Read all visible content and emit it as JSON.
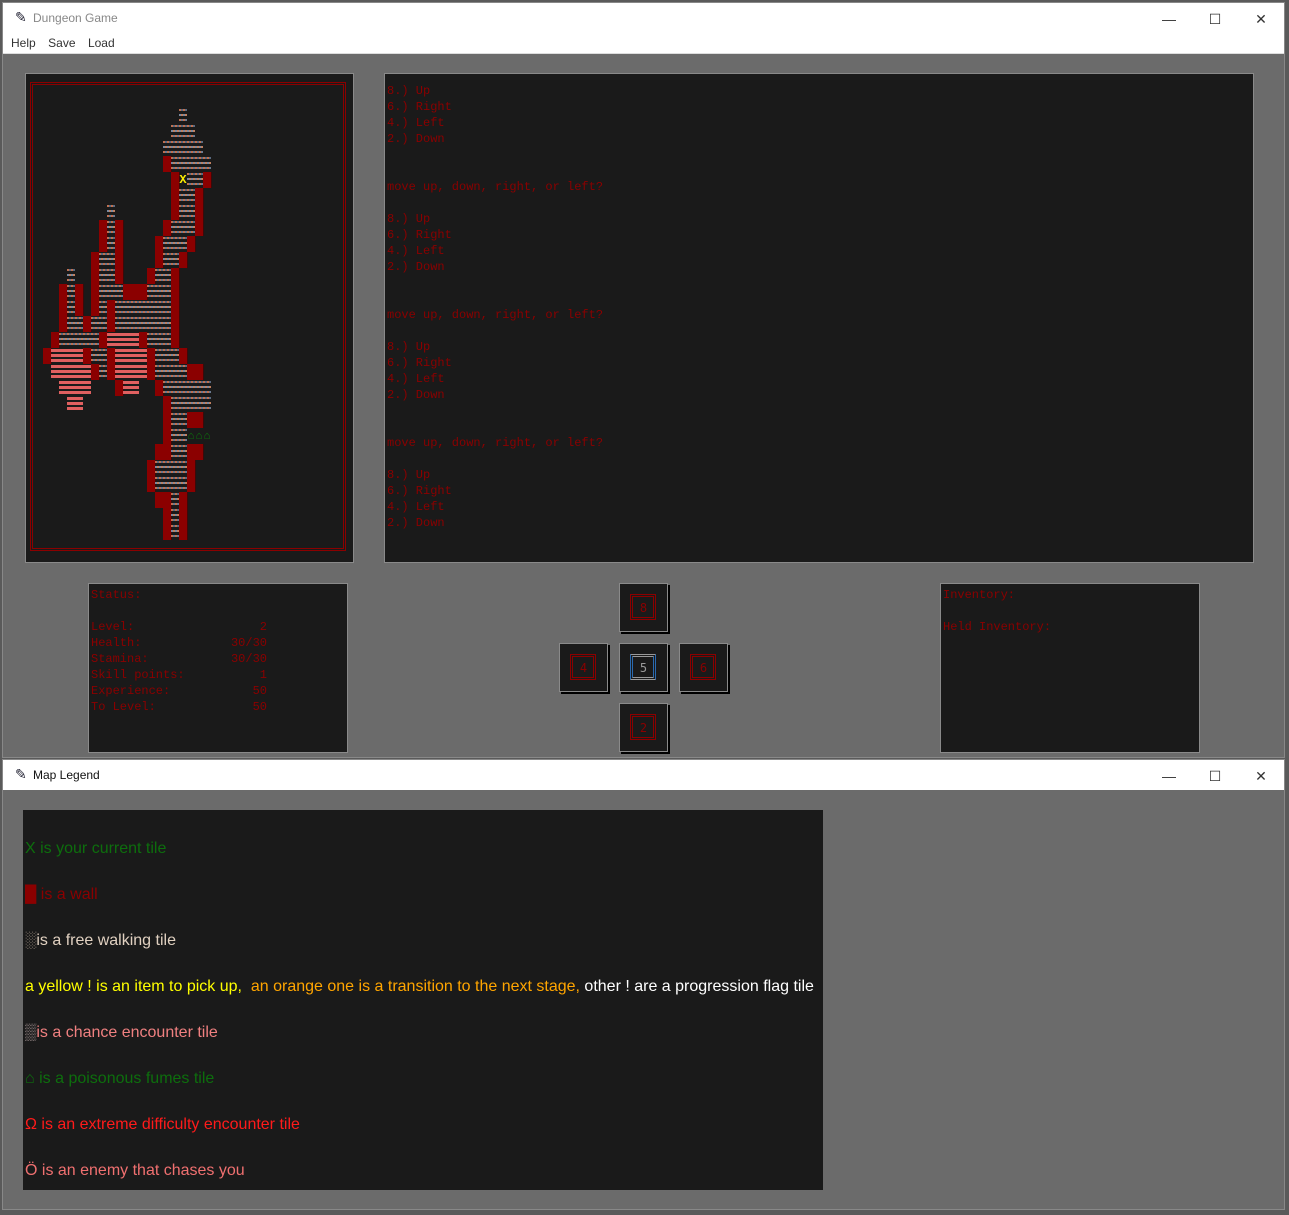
{
  "main_window": {
    "title": "Dungeon Game",
    "menu": [
      "Help",
      "Save",
      "Load"
    ],
    "controls": {
      "minimize": "—",
      "maximize": "☐",
      "close": "✕"
    }
  },
  "map": {
    "legend_codes": {
      "#": "wall",
      ".": "free walking tile",
      "p": "chance encounter tile",
      "X": "current tile",
      "f": "poisonous fumes tile"
    },
    "player_glyph": "X",
    "fumes_glyph": "⌂",
    "rows": [
      "",
      "                  .",
      "                 ...",
      "                .....",
      "                #.....",
      "                 #X..#",
      "                 #..#",
      "         .       #..#",
      "        #.#     #...#",
      "        #.#    #...#",
      "       #..#    #..#",
      "    .  #..#   #..#",
      "   #.# #...###...#",
      "   #.# #.#.......#",
      "   #..#..#.......#",
      "  #.....#pppp#...#",
      " #pppp#..#pppp#...#",
      "  ppppp#.#pppp#....##",
      "   pppp   #pp  #......",
      "    pp          #.....",
      "                #..##",
      "                #..fff",
      "               ##..##",
      "              #....#",
      "              #....#",
      "               ##.#",
      "                #.#",
      "                #.#"
    ]
  },
  "log": {
    "lines": [
      "8.) Up",
      "6.) Right",
      "4.) Left",
      "2.) Down",
      "",
      "",
      "move up, down, right, or left?",
      "",
      "8.) Up",
      "6.) Right",
      "4.) Left",
      "2.) Down",
      "",
      "",
      "move up, down, right, or left?",
      "",
      "8.) Up",
      "6.) Right",
      "4.) Left",
      "2.) Down",
      "",
      "",
      "move up, down, right, or left?",
      "",
      "8.) Up",
      "6.) Right",
      "4.) Left",
      "2.) Down"
    ]
  },
  "status": {
    "title": "Status:",
    "rows": [
      {
        "label": "Level:",
        "value": "2"
      },
      {
        "label": "Health:",
        "value": "30/30"
      },
      {
        "label": "Stamina:",
        "value": "30/30"
      },
      {
        "label": "Skill points:",
        "value": "1"
      },
      {
        "label": "Experience:",
        "value": "50"
      },
      {
        "label": "To Level:",
        "value": "50"
      }
    ]
  },
  "dpad": {
    "up": "8",
    "left": "4",
    "center": "5",
    "right": "6",
    "down": "2"
  },
  "inventory": {
    "title": "Inventory:",
    "held_title": "Held Inventory:"
  },
  "legend_window": {
    "title": "Map Legend",
    "controls": {
      "minimize": "—",
      "maximize": "☐",
      "close": "✕"
    },
    "lines": [
      {
        "segments": [
          {
            "text": "X is your current tile",
            "color": "#0d6e0d"
          }
        ]
      },
      {
        "segments": [
          {
            "text": "█",
            "color": "#8b0000"
          },
          {
            "text": " is a wall",
            "color": "#8b0000"
          }
        ]
      },
      {
        "segments": [
          {
            "text": "░",
            "color": "#b0a090"
          },
          {
            "text": "is a free walking tile",
            "color": "#e0d0c0"
          }
        ]
      },
      {
        "segments": [
          {
            "text": "a yellow ! is an item to pick up,",
            "color": "#ffff00"
          },
          {
            "text": "  an orange one is a transition to the next stage,",
            "color": "#ffa500"
          },
          {
            "text": " other ! are a progression flag tile",
            "color": "#ffffff"
          }
        ]
      },
      {
        "segments": [
          {
            "text": "▒",
            "color": "#a09090"
          },
          {
            "text": "is a chance encounter tile",
            "color": "#f08080"
          }
        ]
      },
      {
        "segments": [
          {
            "text": "⌂ is a poisonous fumes tile",
            "color": "#0d6e0d"
          }
        ]
      },
      {
        "segments": [
          {
            "text": "Ω is an extreme difficulty encounter tile",
            "color": "#ff1a1a"
          }
        ]
      },
      {
        "segments": [
          {
            "text": "Ö is an enemy that chases you",
            "color": "#f07070"
          }
        ]
      }
    ]
  }
}
